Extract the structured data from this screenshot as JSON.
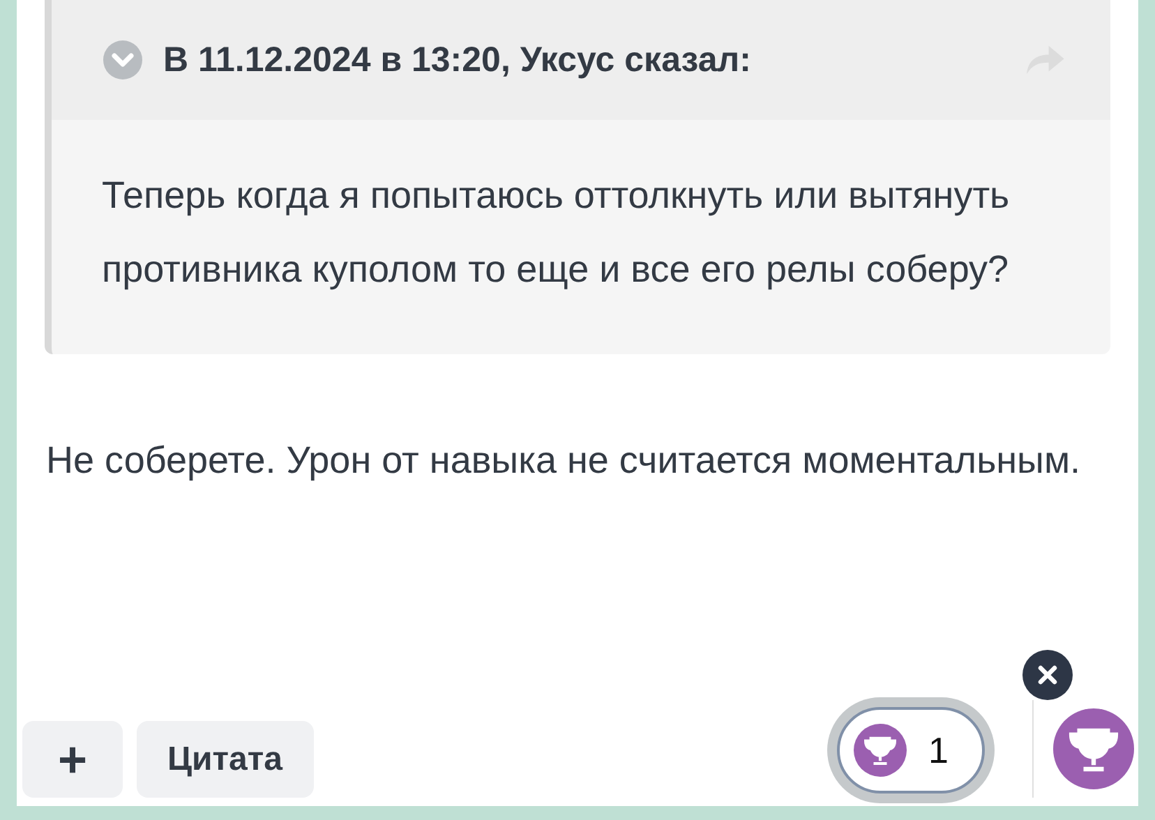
{
  "quote": {
    "header": "В 11.12.2024 в 13:20, Уксус сказал:",
    "text": "Теперь когда я попытаюсь оттолкнуть или вытянуть противника куполом то еще и все его релы соберу?"
  },
  "reply": "Не соберете. Урон от навыка не считается моментальным.",
  "actions": [
    {
      "kind": "plus",
      "label": "+"
    },
    {
      "kind": "text",
      "label": "Цитата"
    }
  ],
  "reaction": {
    "count": "1",
    "selected": true
  }
}
